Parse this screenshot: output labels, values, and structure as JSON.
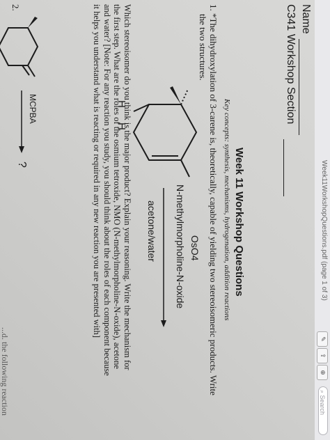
{
  "window": {
    "title": "Week11WorkshopQuestions.pdf (page 1 of 3)",
    "search_placeholder": "Search"
  },
  "toolbar": {
    "pen_tool": "✎",
    "share_tool": "⇪",
    "markup_tool": "⊕"
  },
  "header": {
    "name_label": "Name",
    "section_label": "C341 Workshop Section"
  },
  "worksheet": {
    "title": "Week 11 Workshop Questions",
    "key_concepts": "Key concepts:  synthesis, mechanisms, hydrogenation, addition reactions",
    "q1_number": "1.",
    "q1_line1": "*The dihydroxylation of 3-carene is, theoretically, capable of yielding two stereoisomeric products. Write",
    "q1_line2": "the two structures.",
    "h_top": "H",
    "h_bottom": "H",
    "reagent_1": "OsO4",
    "reagent_2": "N-methylmorpholine-N-oxide",
    "reagent_3": "acetone/water",
    "para_line1": "Which stereoisomer do you think is the major product? Explain your reasoning.  Write the mechanism for",
    "para_line2": "the first step.  What are the roles of the osmium tetroxide, NMO (N-methylmorpholine-N-oxide), acetone",
    "para_line3": "and water? [Note: For any reaction you study, you should think about the roles of each component because",
    "para_line4": "it helps you understand what is reacting or required in any new reaction you are presented with]",
    "q2_number": "2.",
    "q2_reagent": "MCPBA",
    "q2_product": "?",
    "cut_text": "...d. the following reaction"
  }
}
